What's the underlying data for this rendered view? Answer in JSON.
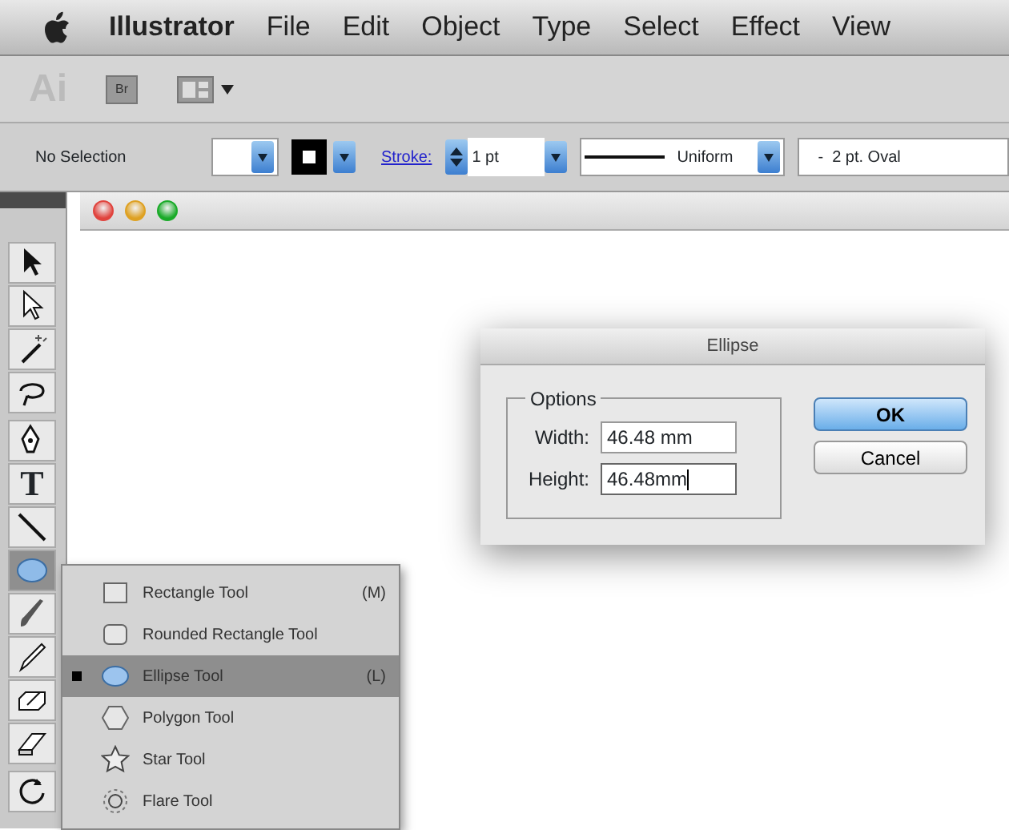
{
  "menu_bar": {
    "items": [
      "Illustrator",
      "File",
      "Edit",
      "Object",
      "Type",
      "Select",
      "Effect",
      "View"
    ]
  },
  "app_bar": {
    "logo": "Ai",
    "bridge_button": "Br"
  },
  "control_bar": {
    "selection": "No Selection",
    "stroke_label": "Stroke:",
    "stroke_weight": "1 pt",
    "stroke_profile": "Uniform",
    "brush": "-  2 pt. Oval"
  },
  "tools": [
    {
      "kind": "selection",
      "selected": false
    },
    {
      "kind": "direct-selection",
      "selected": false
    },
    {
      "kind": "magic-wand",
      "selected": false
    },
    {
      "kind": "lasso",
      "selected": false
    },
    {
      "kind": "pen",
      "selected": false
    },
    {
      "kind": "type",
      "glyph": "T",
      "selected": false
    },
    {
      "kind": "line",
      "selected": false
    },
    {
      "kind": "ellipse",
      "selected": true
    },
    {
      "kind": "paintbrush",
      "selected": false
    },
    {
      "kind": "pencil",
      "selected": false
    },
    {
      "kind": "blob",
      "selected": false
    },
    {
      "kind": "eraser",
      "selected": false
    },
    {
      "kind": "rotate",
      "selected": false
    }
  ],
  "flyout_menu": {
    "items": [
      {
        "kind": "rectangle",
        "label": "Rectangle Tool",
        "shortcut": "(M)",
        "selected": false
      },
      {
        "kind": "rounded-rectangle",
        "label": "Rounded Rectangle Tool",
        "selected": false
      },
      {
        "kind": "ellipse",
        "label": "Ellipse Tool",
        "shortcut": "(L)",
        "selected": true
      },
      {
        "kind": "polygon",
        "label": "Polygon Tool",
        "selected": false
      },
      {
        "kind": "star",
        "label": "Star Tool",
        "selected": false
      },
      {
        "kind": "flare",
        "label": "Flare Tool",
        "selected": false
      }
    ]
  },
  "dialog": {
    "title": "Ellipse",
    "group": "Options",
    "fields": [
      {
        "label": "Width:",
        "value": "46.48 mm",
        "focused": false
      },
      {
        "label": "Height:",
        "value": "46.48mm",
        "focused": true
      }
    ],
    "buttons": [
      {
        "label": "OK",
        "default": true
      },
      {
        "label": "Cancel",
        "default": false
      }
    ]
  }
}
